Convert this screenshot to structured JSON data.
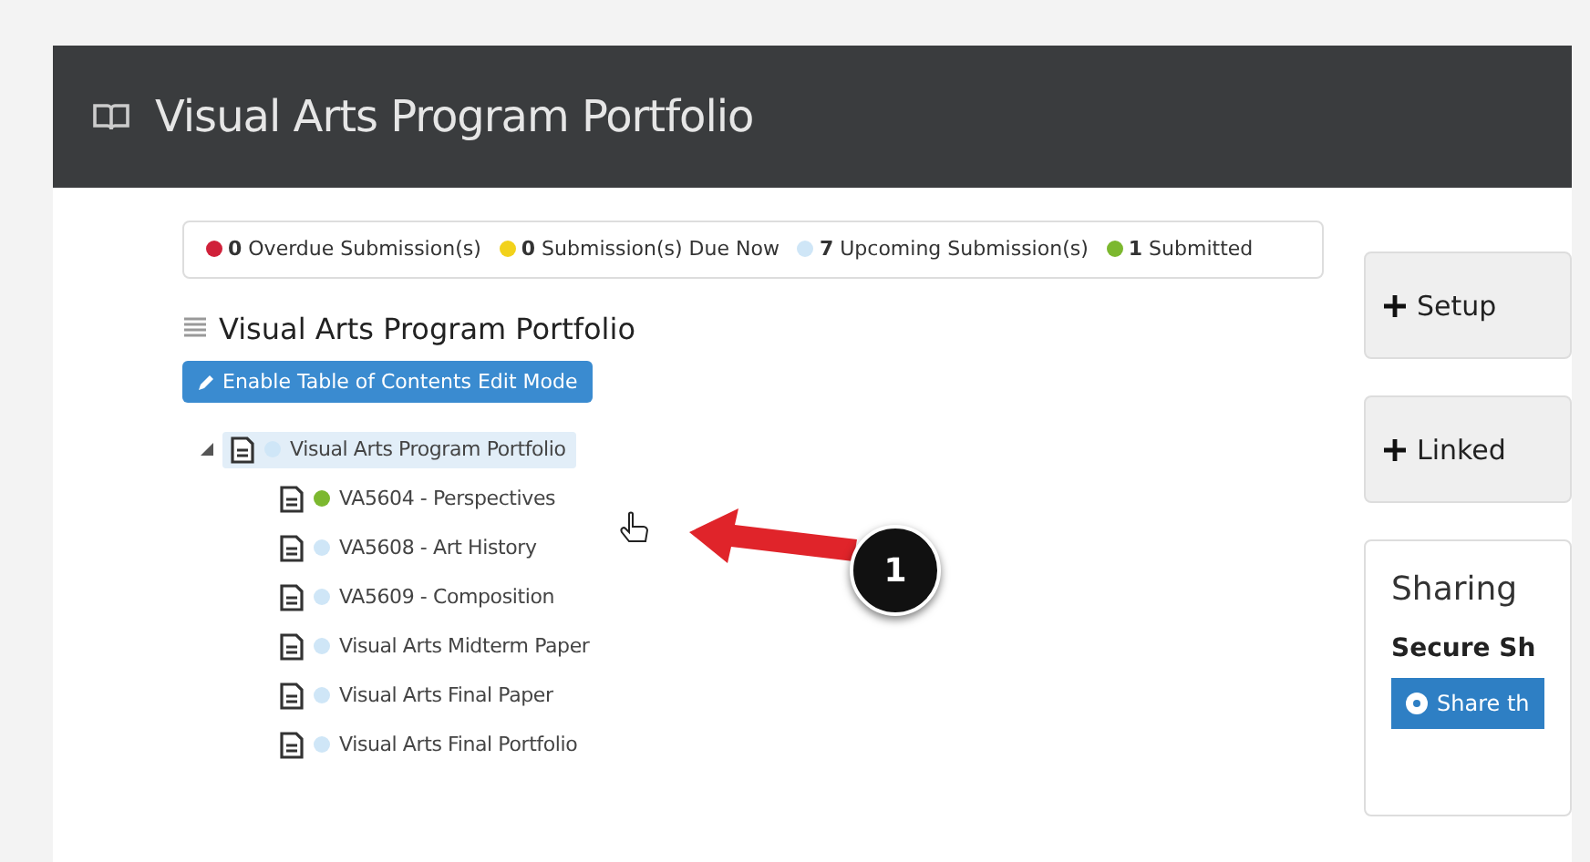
{
  "header": {
    "title": "Visual Arts Program Portfolio"
  },
  "summary": [
    {
      "count": "0",
      "label": "Overdue Submission(s)",
      "color": "#d0213a"
    },
    {
      "count": "0",
      "label": "Submission(s) Due Now",
      "color": "#f2d21b"
    },
    {
      "count": "7",
      "label": "Upcoming Submission(s)",
      "color": "#cfe6f7"
    },
    {
      "count": "1",
      "label": "Submitted",
      "color": "#7cb82f"
    }
  ],
  "section_title": "Visual Arts Program Portfolio",
  "edit_button": "Enable Table of Contents Edit Mode",
  "tree": [
    {
      "label": "Visual Arts Program Portfolio",
      "color": "#cfe6f7",
      "selected": true,
      "expanded": true,
      "children": [
        {
          "label": "VA5604 - Perspectives",
          "color": "#7cb82f",
          "selected": false
        },
        {
          "label": "VA5608 - Art History",
          "color": "#cfe6f7",
          "selected": false
        },
        {
          "label": "VA5609 - Composition",
          "color": "#cfe6f7",
          "selected": false
        },
        {
          "label": "Visual Arts Midterm Paper",
          "color": "#cfe6f7",
          "selected": false
        },
        {
          "label": "Visual Arts Final Paper",
          "color": "#cfe6f7",
          "selected": false
        },
        {
          "label": "Visual Arts Final Portfolio",
          "color": "#cfe6f7",
          "selected": false
        }
      ]
    }
  ],
  "side_panels": [
    {
      "kind": "collapsed",
      "label": "Setup"
    },
    {
      "kind": "collapsed",
      "label": "Linked"
    },
    {
      "kind": "sharing",
      "title": "Sharing",
      "subtitle": "Secure Sh",
      "button": "Share th"
    }
  ],
  "callout": {
    "number": "1"
  }
}
